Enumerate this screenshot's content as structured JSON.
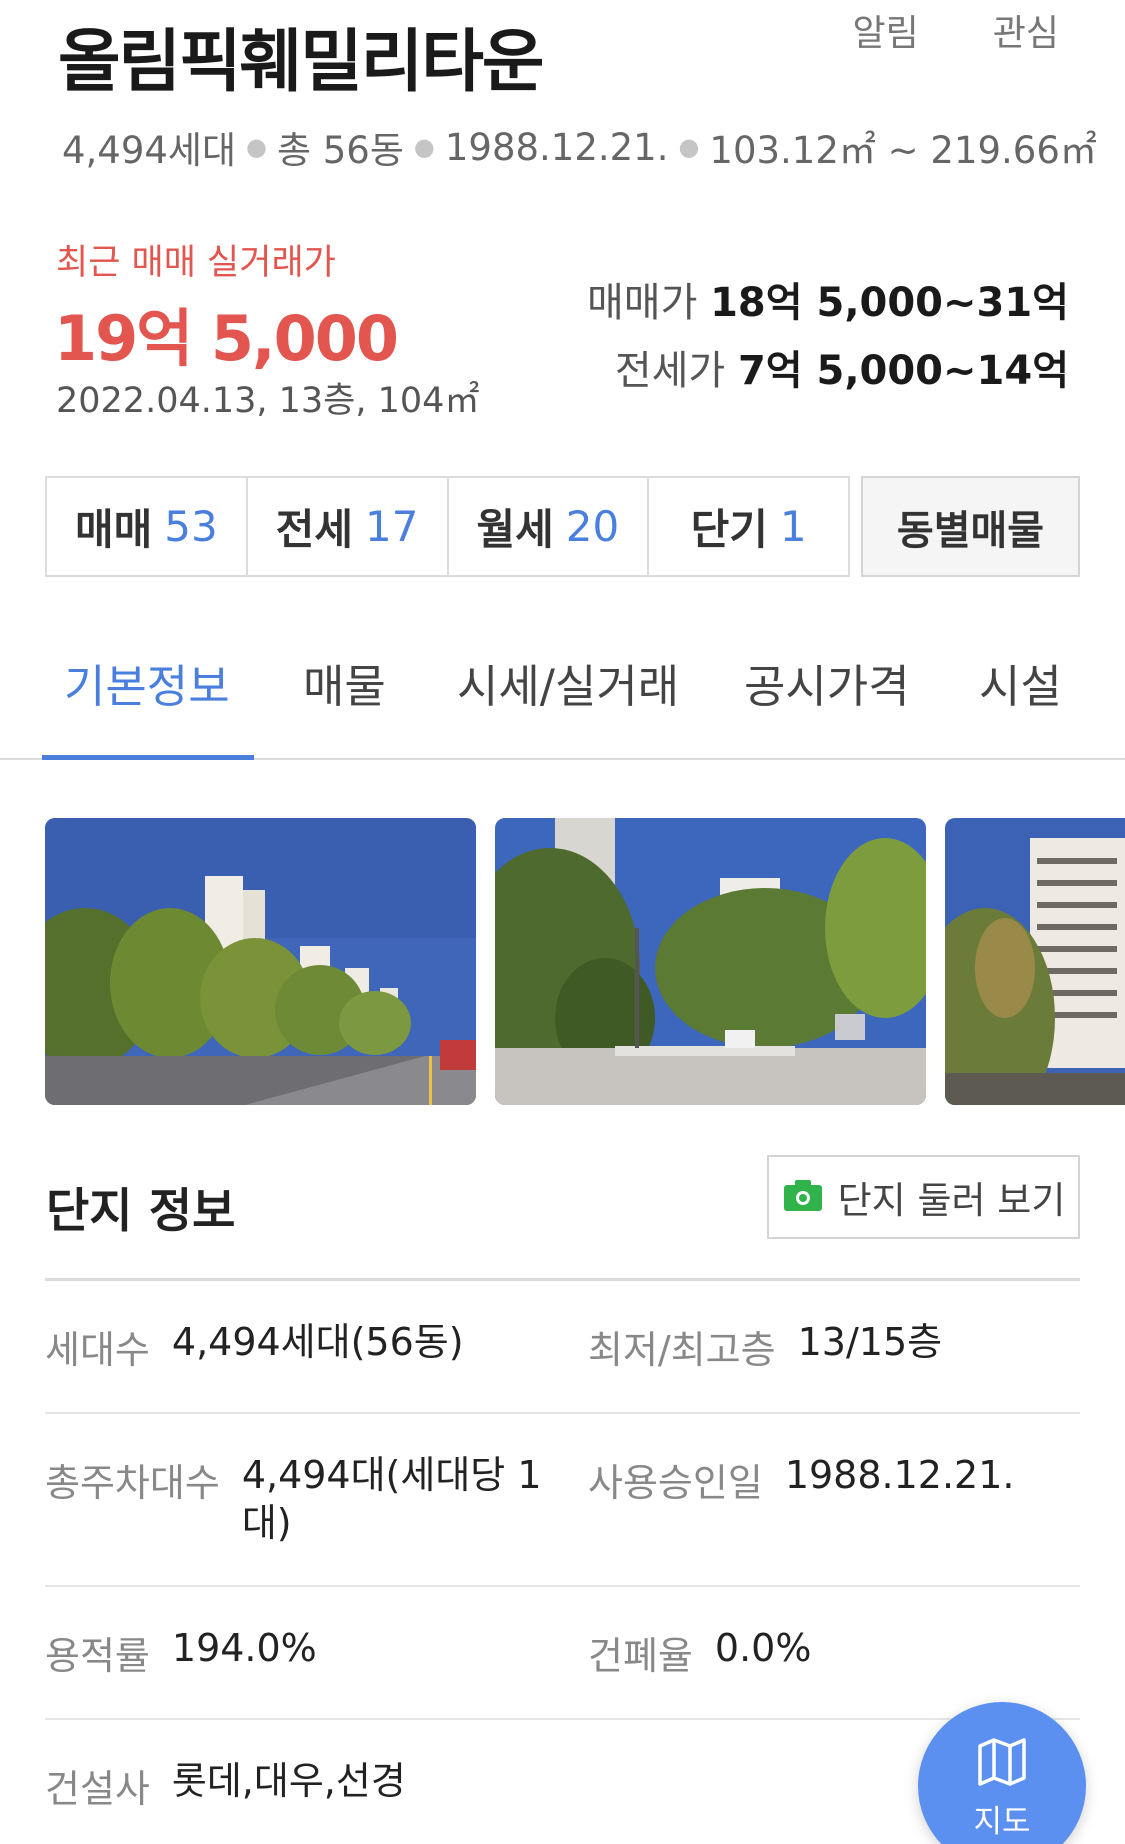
{
  "header": {
    "title": "올림픽훼밀리타운",
    "alert_label": "알림",
    "favorite_label": "관심"
  },
  "summary": {
    "households": "4,494세대",
    "buildings": "총 56동",
    "approval_date": "1988.12.21.",
    "area_range": "103.12㎡ ~ 219.66㎡"
  },
  "recent_trade": {
    "label": "최근 매매 실거래가",
    "price": "19억 5,000",
    "detail": "2022.04.13, 13층, 104㎡"
  },
  "price_ranges": {
    "sale_label": "매매가",
    "sale_value": "18억 5,000~31억",
    "jeonse_label": "전세가",
    "jeonse_value": "7억 5,000~14억"
  },
  "listing_counts": [
    {
      "label": "매매",
      "count": "53"
    },
    {
      "label": "전세",
      "count": "17"
    },
    {
      "label": "월세",
      "count": "20"
    },
    {
      "label": "단기",
      "count": "1"
    }
  ],
  "by_building_label": "동별매물",
  "tabs": [
    {
      "label": "기본정보",
      "active": true
    },
    {
      "label": "매물",
      "active": false
    },
    {
      "label": "시세/실거래",
      "active": false
    },
    {
      "label": "공시가격",
      "active": false
    },
    {
      "label": "시설",
      "active": false
    }
  ],
  "complex_info": {
    "title": "단지 정보",
    "tour_button_label": "단지 둘러 보기",
    "tour_icon": "camera-icon",
    "rows": [
      [
        {
          "key": "세대수",
          "value": "4,494세대(56동)"
        },
        {
          "key": "최저/최고층",
          "value": "13/15층"
        }
      ],
      [
        {
          "key": "총주차대수",
          "value": "4,494대(세대당 1대)"
        },
        {
          "key": "사용승인일",
          "value": "1988.12.21."
        }
      ],
      [
        {
          "key": "용적률",
          "value": "194.0%"
        },
        {
          "key": "건폐율",
          "value": "0.0%"
        }
      ],
      [
        {
          "key": "건설사",
          "value": "롯데,대우,선경"
        }
      ]
    ]
  },
  "map_button": {
    "label": "지도",
    "icon": "map-icon"
  },
  "colors": {
    "accent_blue": "#4a7fde",
    "price_red": "#e3554f",
    "fab_blue": "#5b8ff0",
    "camera_green": "#2fb34a"
  }
}
